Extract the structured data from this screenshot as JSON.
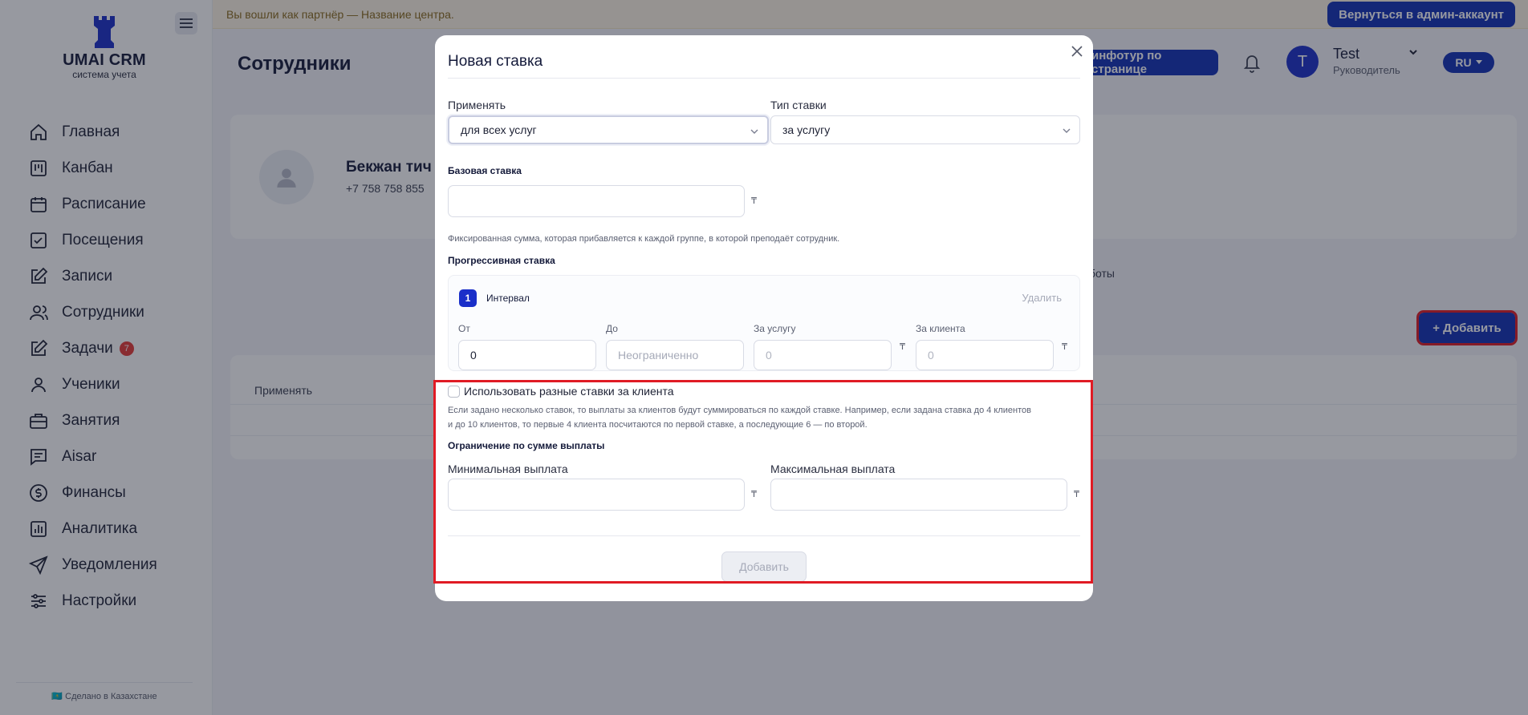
{
  "sidebar": {
    "logo_title": "UMAI CRM",
    "logo_subtitle": "система учета",
    "items": [
      {
        "label": "Главная",
        "icon": "home-icon"
      },
      {
        "label": "Канбан",
        "icon": "kanban-icon"
      },
      {
        "label": "Расписание",
        "icon": "calendar-icon"
      },
      {
        "label": "Посещения",
        "icon": "attendance-icon"
      },
      {
        "label": "Записи",
        "icon": "edit-icon"
      },
      {
        "label": "Сотрудники",
        "icon": "users-icon"
      },
      {
        "label": "Задачи",
        "icon": "tasks-icon",
        "badge": "7"
      },
      {
        "label": "Ученики",
        "icon": "user-icon"
      },
      {
        "label": "Занятия",
        "icon": "briefcase-icon"
      },
      {
        "label": "Aisar",
        "icon": "chat-icon"
      },
      {
        "label": "Финансы",
        "icon": "dollar-icon"
      },
      {
        "label": "Аналитика",
        "icon": "chart-icon"
      },
      {
        "label": "Уведомления",
        "icon": "send-icon"
      },
      {
        "label": "Настройки",
        "icon": "settings-icon"
      }
    ],
    "footer": "🇰🇿 Сделано в Казахстане"
  },
  "banner": {
    "text": "Вы вошли как партнёр — Название центра.",
    "button": "Вернуться в админ-аккаунт"
  },
  "header": {
    "title": "Сотрудники",
    "tour_button": "инфотур по странице",
    "user_initial": "T",
    "user_name": "Test",
    "user_role": "Руководитель",
    "language": "RU"
  },
  "background": {
    "employee_name": "Бекжан тич",
    "employee_phone": "+7 758 758 855",
    "tab_fragment": "боты",
    "add_button": "+ Добавить",
    "table_header": "Применять"
  },
  "modal": {
    "title": "Новая ставка",
    "apply_label": "Применять",
    "apply_value": "для всех услуг",
    "rate_type_label": "Тип ставки",
    "rate_type_value": "за услугу",
    "base_rate_title": "Базовая ставка",
    "base_rate_value": "",
    "base_rate_hint": "Фиксированная сумма, которая прибавляется к каждой группе, в которой преподаёт сотрудник.",
    "currency": "₸",
    "progressive_title": "Прогрессивная ставка",
    "interval": {
      "number": "1",
      "title": "Интервал",
      "delete": "Удалить",
      "from_label": "От",
      "from_value": "0",
      "to_label": "До",
      "to_placeholder": "Неограниченно",
      "per_service_label": "За услугу",
      "per_service_value": "0",
      "per_client_label": "За клиента",
      "per_client_value": "0"
    },
    "checkbox_label": "Использовать разные ставки за клиента",
    "checkbox_checked": false,
    "multi_rate_hint_line1": "Если задано несколько ставок, то выплаты за клиентов будут суммироваться по каждой ставке. Например, если задана ставка до 4 клиентов",
    "multi_rate_hint_line2": "и до 10 клиентов, то первые 4 клиента посчитаются по первой ставке, а последующие 6 — по второй.",
    "limit_title": "Ограничение по сумме выплаты",
    "min_label": "Минимальная выплата",
    "min_value": "",
    "max_label": "Максимальная выплата",
    "max_value": "",
    "submit": "Добавить"
  },
  "colors": {
    "primary": "#1230b5",
    "highlight": "#e01b24",
    "badge": "#e53935"
  }
}
